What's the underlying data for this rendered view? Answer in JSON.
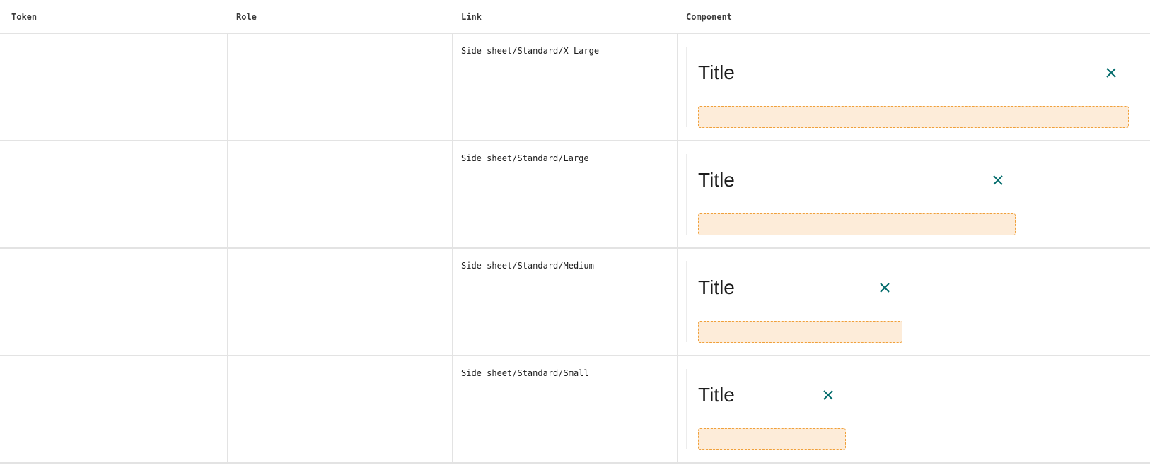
{
  "table": {
    "headers": {
      "token": "Token",
      "role": "Role",
      "link": "Link",
      "component": "Component"
    },
    "rows": [
      {
        "token": "",
        "role": "",
        "link": "Side sheet/Standard/X Large",
        "component": {
          "title": "Title",
          "close_icon": "close-icon"
        }
      },
      {
        "token": "",
        "role": "",
        "link": "Side sheet/Standard/Large",
        "component": {
          "title": "Title",
          "close_icon": "close-icon"
        }
      },
      {
        "token": "",
        "role": "",
        "link": "Side sheet/Standard/Medium",
        "component": {
          "title": "Title",
          "close_icon": "close-icon"
        }
      },
      {
        "token": "",
        "role": "",
        "link": "Side sheet/Standard/Small",
        "component": {
          "title": "Title",
          "close_icon": "close-icon"
        }
      }
    ]
  },
  "colors": {
    "divider": "#e3e3e3",
    "close_icon": "#006a6a",
    "slot_fill": "#fdecd9",
    "slot_border": "#f0a03a"
  }
}
